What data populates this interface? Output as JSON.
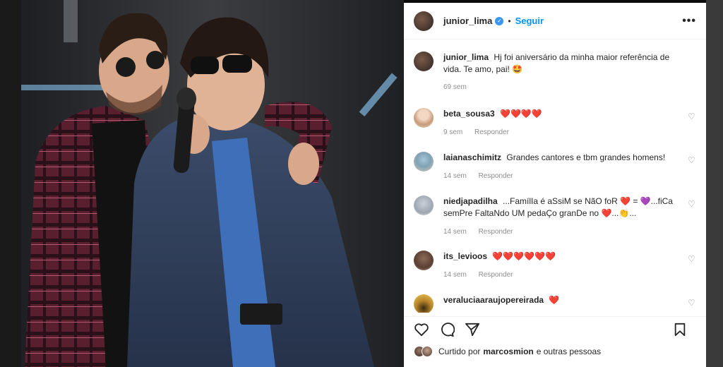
{
  "post": {
    "username": "junior_lima",
    "separator": "•",
    "follow_label": "Seguir",
    "more_label": "•••"
  },
  "caption": {
    "username": "junior_lima",
    "text": "Hj foi aniversário da minha maior referência de vida. Te amo, pai! 🤩",
    "time": "69 sem"
  },
  "comments": [
    {
      "user": "beta_sousa3",
      "text": "❤️❤️❤️❤️",
      "time": "9 sem",
      "reply": "Responder"
    },
    {
      "user": "laianaschimitz",
      "text": "Grandes cantores e tbm grandes homens!",
      "time": "14 sem",
      "reply": "Responder"
    },
    {
      "user": "niedjapadilha",
      "text": "...FamílIa é aSsiM se NãO foR ❤️ = 💜...fiCa semPre FaltaNdo UM pedaÇo granDe no ❤️...👏...",
      "time": "14 sem",
      "reply": "Responder"
    },
    {
      "user": "its_levioos",
      "text": "❤️❤️❤️❤️❤️❤️",
      "time": "14 sem",
      "reply": "Responder"
    },
    {
      "user": "veraluciaaraujopereirada",
      "text": "❤️",
      "time": "",
      "reply": ""
    }
  ],
  "likes": {
    "prefix": "Curtido por",
    "user": "marcosmion",
    "suffix": "e outras pessoas"
  },
  "colors": {
    "link_blue": "#0095f6",
    "heart_red": "#ed4956",
    "meta_gray": "#8e8e8e"
  },
  "icons": [
    "verified-badge-icon",
    "more-options-icon",
    "heart-icon",
    "comment-icon",
    "share-icon",
    "bookmark-icon"
  ]
}
